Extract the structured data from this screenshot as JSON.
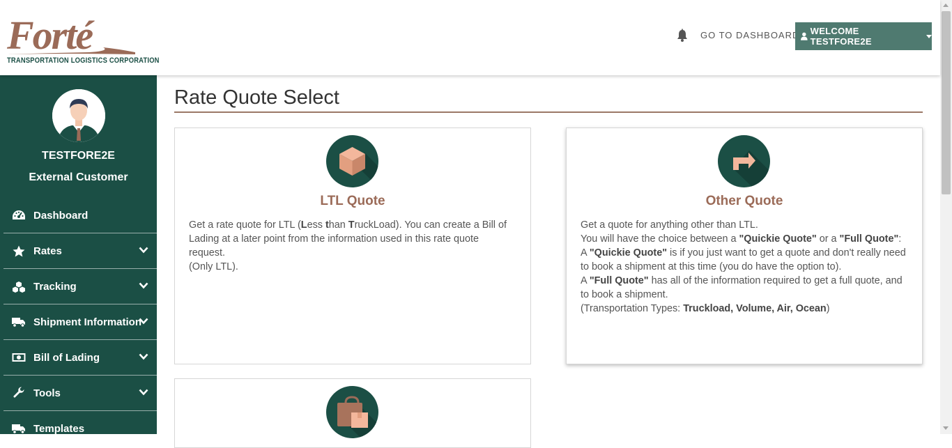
{
  "logo": {
    "word": "Forté",
    "tagline": "TRANSPORTATION LOGISTICS CORPORATION"
  },
  "header": {
    "bell_icon": "bell-icon",
    "go_dashboard": "GO TO DASHBOARD",
    "welcome": "WELCOME TESTFORE2E"
  },
  "user": {
    "name": "TESTFORE2E",
    "role": "External Customer"
  },
  "sidebar": {
    "items": [
      {
        "label": "Dashboard",
        "icon": "tachometer-icon",
        "has_chevron": false
      },
      {
        "label": "Rates",
        "icon": "star-icon",
        "has_chevron": true
      },
      {
        "label": "Tracking",
        "icon": "cubes-icon",
        "has_chevron": true
      },
      {
        "label": "Shipment Information",
        "icon": "truck-icon",
        "has_chevron": true
      },
      {
        "label": "Bill of Lading",
        "icon": "money-bill-icon",
        "has_chevron": true
      },
      {
        "label": "Tools",
        "icon": "wrench-icon",
        "has_chevron": true
      },
      {
        "label": "Templates",
        "icon": "truck-icon",
        "has_chevron": false
      }
    ]
  },
  "page": {
    "title": "Rate Quote Select"
  },
  "cards": {
    "ltl": {
      "title": "LTL Quote",
      "icon": "box-icon",
      "body_parts": [
        "Get a rate quote for LTL (",
        "L",
        "ess ",
        "t",
        "han ",
        "T",
        "ruckLoad). You can create a Bill of Lading at a later point from the information used in this rate quote request."
      ],
      "body_note": "(Only LTL)."
    },
    "other": {
      "title": "Other Quote",
      "icon": "turn-right-arrow-icon",
      "line1": "Get a quote for anything other than LTL.",
      "line2_pre": "You will have the choice between a ",
      "line2_b1": "\"Quickie Quote\"",
      "line2_mid": " or a ",
      "line2_b2": "\"Full Quote\"",
      "line2_post": ":",
      "line3_pre": "A ",
      "line3_b": "\"Quickie Quote\"",
      "line3_post": " is if you just want to get a quote and don't really need to book a shipment at this time (you do have the option to).",
      "line4_pre": "A ",
      "line4_b": "\"Full Quote\"",
      "line4_post": " has all of the information required to get a full quote, and to book a shipment.",
      "line5_pre": "(Transportation Types: ",
      "line5_b": "Truckload, Volume, Air, Ocean",
      "line5_post": ")"
    },
    "third": {
      "icon": "bag-box-icon"
    }
  },
  "colors": {
    "sidebar": "#1b4f45",
    "accent_brown": "#9b6b58",
    "welcome_button": "#4f7a70"
  }
}
